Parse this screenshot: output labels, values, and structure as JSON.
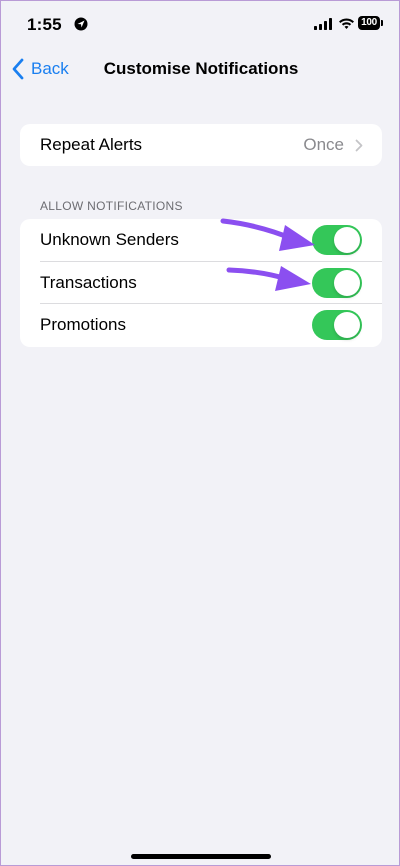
{
  "status_bar": {
    "time": "1:55",
    "battery": "100"
  },
  "nav": {
    "back_label": "Back",
    "title": "Customise Notifications"
  },
  "repeat_alerts": {
    "label": "Repeat Alerts",
    "value": "Once"
  },
  "allow_notifications": {
    "header": "ALLOW NOTIFICATIONS",
    "items": [
      {
        "label": "Unknown Senders",
        "enabled": true
      },
      {
        "label": "Transactions",
        "enabled": true
      },
      {
        "label": "Promotions",
        "enabled": true
      }
    ]
  },
  "colors": {
    "accent": "#1a7ff0",
    "toggle_on": "#34c759",
    "annotation_arrow": "#8b4ff0"
  }
}
